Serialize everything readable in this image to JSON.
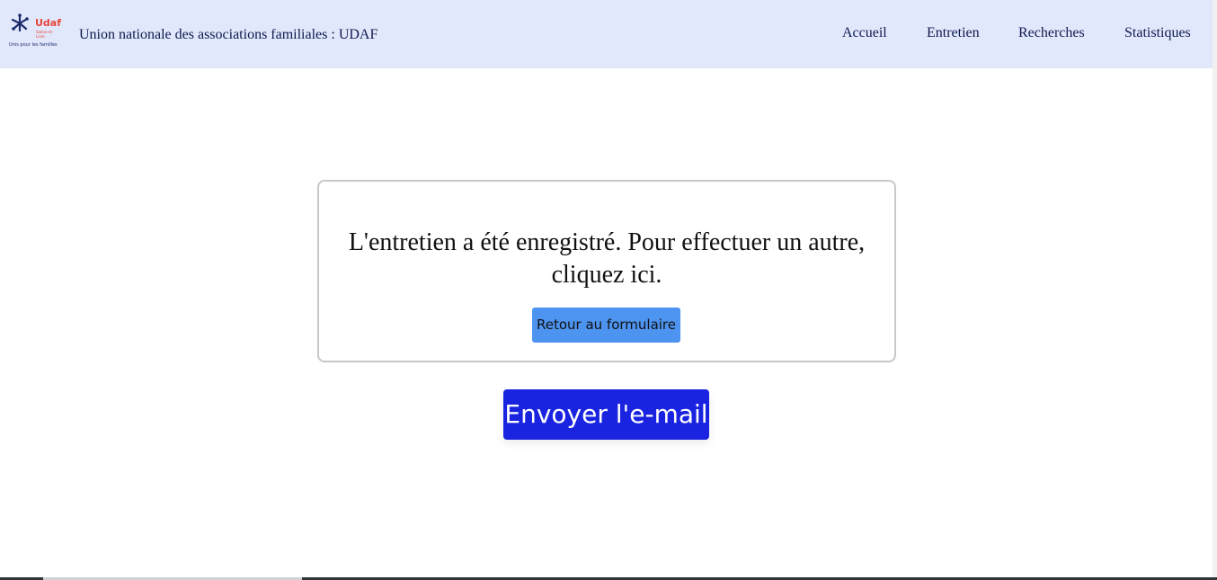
{
  "header": {
    "logo": {
      "text": "Udaf",
      "subtext": "Saône-et-Loire",
      "tagline": "Unis pour les familles"
    },
    "title": "Union nationale des associations familiales : UDAF",
    "nav": {
      "accueil": "Accueil",
      "entretien": "Entretien",
      "recherches": "Recherches",
      "statistiques": "Statistiques"
    }
  },
  "main": {
    "message": "L'entretien a été enregistré. Pour effectuer un autre, cliquez ici.",
    "retour_label": "Retour au formulaire",
    "email_label": "Envoyer l'e-mail"
  },
  "colors": {
    "navbar_bg": "#e2e8fc",
    "retour_bg": "#4d94f0",
    "email_bg": "#1a24e0",
    "logo_red": "#e8443a",
    "logo_navy": "#1b2b6b"
  }
}
